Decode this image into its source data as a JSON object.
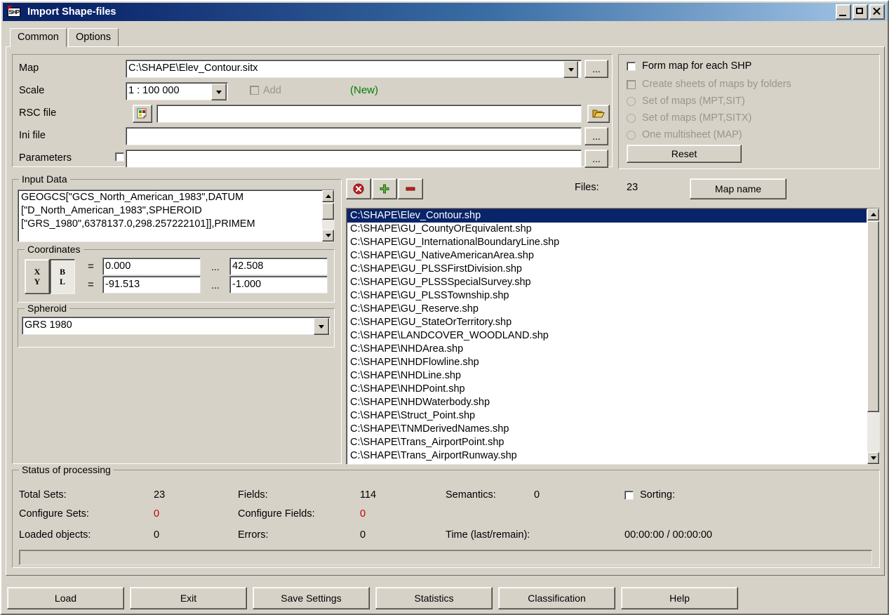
{
  "window": {
    "title": "Import Shape-files",
    "icon": "shp-file-icon",
    "controls": {
      "minimize": "minimize-button",
      "maximize": "maximize-button",
      "close": "close-button"
    }
  },
  "tabs": [
    {
      "label": "Common",
      "active": true
    },
    {
      "label": "Options",
      "active": false
    }
  ],
  "form": {
    "map_label": "Map",
    "map_value": "C:\\SHAPE\\Elev_Contour.sitx",
    "map_browse": "...",
    "scale_label": "Scale",
    "scale_value": "1 : 100 000",
    "add_label": "Add",
    "new_label": "(New)",
    "rsc_label": "RSC file",
    "rsc_value": "",
    "rsc_browse": "folder-icon",
    "ini_label": "Ini file",
    "ini_value": "",
    "ini_browse": "...",
    "params_label": "Parameters",
    "params_value": "",
    "params_browse": "..."
  },
  "options_panel": {
    "form_map_each_shp": "Form map for each SHP",
    "create_sheets_by_folders": "Create sheets of maps by folders",
    "radio_mpt_sit": "Set of maps (MPT,SIT)",
    "radio_mpt_sitx": "Set of maps (MPT,SITX)",
    "radio_multisheet": "One multisheet (MAP)",
    "reset_label": "Reset"
  },
  "input_data": {
    "title": "Input Data",
    "lines": [
      "GEOGCS[\"GCS_North_American_1983\",DATUM",
      "[\"D_North_American_1983\",SPHEROID",
      "[\"GRS_1980\",6378137.0,298.257222101]],PRIMEM"
    ]
  },
  "coordinates": {
    "title": "Coordinates",
    "toggle_xy": "X\nY",
    "toggle_xy_line1": "X",
    "toggle_xy_line2": "Y",
    "toggle_bl_line1": "B",
    "toggle_bl_line2": "L",
    "selected_toggle": "BL",
    "eq": "=",
    "dots": "...",
    "row1_left": "0.000",
    "row1_right": "42.508",
    "row2_left": "-91.513",
    "row2_right": "-1.000"
  },
  "spheroid": {
    "title": "Spheroid",
    "value": "GRS 1980"
  },
  "filelist_toolbar": {
    "clear_icon": "clear-all-icon",
    "add_icon": "add-icon",
    "remove_icon": "remove-icon",
    "files_label": "Files:",
    "files_count": "23",
    "map_name_label": "Map name"
  },
  "files": [
    {
      "path": "C:\\SHAPE\\Elev_Contour.shp",
      "selected": true
    },
    {
      "path": "C:\\SHAPE\\GU_CountyOrEquivalent.shp",
      "selected": false
    },
    {
      "path": "C:\\SHAPE\\GU_InternationalBoundaryLine.shp",
      "selected": false
    },
    {
      "path": "C:\\SHAPE\\GU_NativeAmericanArea.shp",
      "selected": false
    },
    {
      "path": "C:\\SHAPE\\GU_PLSSFirstDivision.shp",
      "selected": false
    },
    {
      "path": "C:\\SHAPE\\GU_PLSSSpecialSurvey.shp",
      "selected": false
    },
    {
      "path": "C:\\SHAPE\\GU_PLSSTownship.shp",
      "selected": false
    },
    {
      "path": "C:\\SHAPE\\GU_Reserve.shp",
      "selected": false
    },
    {
      "path": "C:\\SHAPE\\GU_StateOrTerritory.shp",
      "selected": false
    },
    {
      "path": "C:\\SHAPE\\LANDCOVER_WOODLAND.shp",
      "selected": false
    },
    {
      "path": "C:\\SHAPE\\NHDArea.shp",
      "selected": false
    },
    {
      "path": "C:\\SHAPE\\NHDFlowline.shp",
      "selected": false
    },
    {
      "path": "C:\\SHAPE\\NHDLine.shp",
      "selected": false
    },
    {
      "path": "C:\\SHAPE\\NHDPoint.shp",
      "selected": false
    },
    {
      "path": "C:\\SHAPE\\NHDWaterbody.shp",
      "selected": false
    },
    {
      "path": "C:\\SHAPE\\Struct_Point.shp",
      "selected": false
    },
    {
      "path": "C:\\SHAPE\\TNMDerivedNames.shp",
      "selected": false
    },
    {
      "path": "C:\\SHAPE\\Trans_AirportPoint.shp",
      "selected": false
    },
    {
      "path": "C:\\SHAPE\\Trans_AirportRunway.shp",
      "selected": false
    }
  ],
  "status": {
    "title": "Status of processing",
    "total_sets_label": "Total Sets:",
    "total_sets_value": "23",
    "configure_sets_label": "Configure Sets:",
    "configure_sets_value": "0",
    "loaded_objects_label": "Loaded objects:",
    "loaded_objects_value": "0",
    "fields_label": "Fields:",
    "fields_value": "114",
    "configure_fields_label": "Configure Fields:",
    "configure_fields_value": "0",
    "errors_label": "Errors:",
    "errors_value": "0",
    "semantics_label": "Semantics:",
    "semantics_value": "0",
    "sorting_label": "Sorting:",
    "time_label": "Time (last/remain):",
    "time_value": "00:00:00 / 00:00:00"
  },
  "buttons": [
    {
      "label": "Load"
    },
    {
      "label": "Exit"
    },
    {
      "label": "Save Settings"
    },
    {
      "label": "Statistics"
    },
    {
      "label": "Classification"
    },
    {
      "label": "Help"
    }
  ],
  "colors": {
    "title_start": "#0a246a",
    "title_end": "#a6c8e8",
    "face": "#d6d2c8",
    "selection": "#0a246a",
    "warning_red": "#c00000",
    "new_green": "#008000"
  }
}
